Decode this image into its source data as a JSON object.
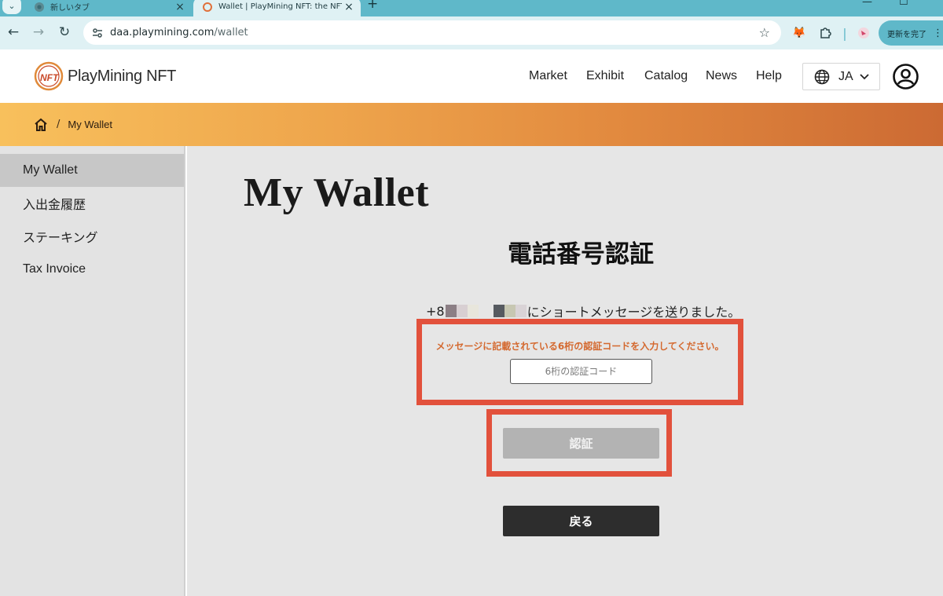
{
  "browser": {
    "tabs": [
      {
        "title": "新しいタブ",
        "active": false
      },
      {
        "title": "Wallet | PlayMining NFT: the NFT marketplace",
        "active": true
      }
    ],
    "url_host": "daa.playmining.com",
    "url_path": "/wallet",
    "update_button": "更新を完了"
  },
  "header": {
    "logo_text": "PlayMining NFT",
    "nav": [
      "Market",
      "Exhibit",
      "Catalog",
      "News",
      "Help"
    ],
    "language": "JA"
  },
  "breadcrumb": {
    "current": "My Wallet",
    "separator": "/"
  },
  "sidebar": {
    "items": [
      {
        "label": "My Wallet",
        "active": true
      },
      {
        "label": "入出金履歴",
        "active": false
      },
      {
        "label": "ステーキング",
        "active": false
      },
      {
        "label": "Tax Invoice",
        "active": false
      }
    ]
  },
  "main": {
    "page_title": "My Wallet",
    "section_title": "電話番号認証",
    "sent_prefix": "+8",
    "sent_suffix": "にショートメッセージを送りました。",
    "instruction": "メッセージに記載されている6桁の認証コードを入力してください。",
    "code_placeholder": "6桁の認証コード",
    "verify_button": "認証",
    "back_button": "戻る"
  },
  "colors": {
    "highlight_border": "#e2513c",
    "instruction_text": "#d4692f",
    "breadcrumb_gradient_start": "#f8c05c",
    "breadcrumb_gradient_end": "#cc6a33",
    "browser_accent": "#5fb8c9"
  }
}
